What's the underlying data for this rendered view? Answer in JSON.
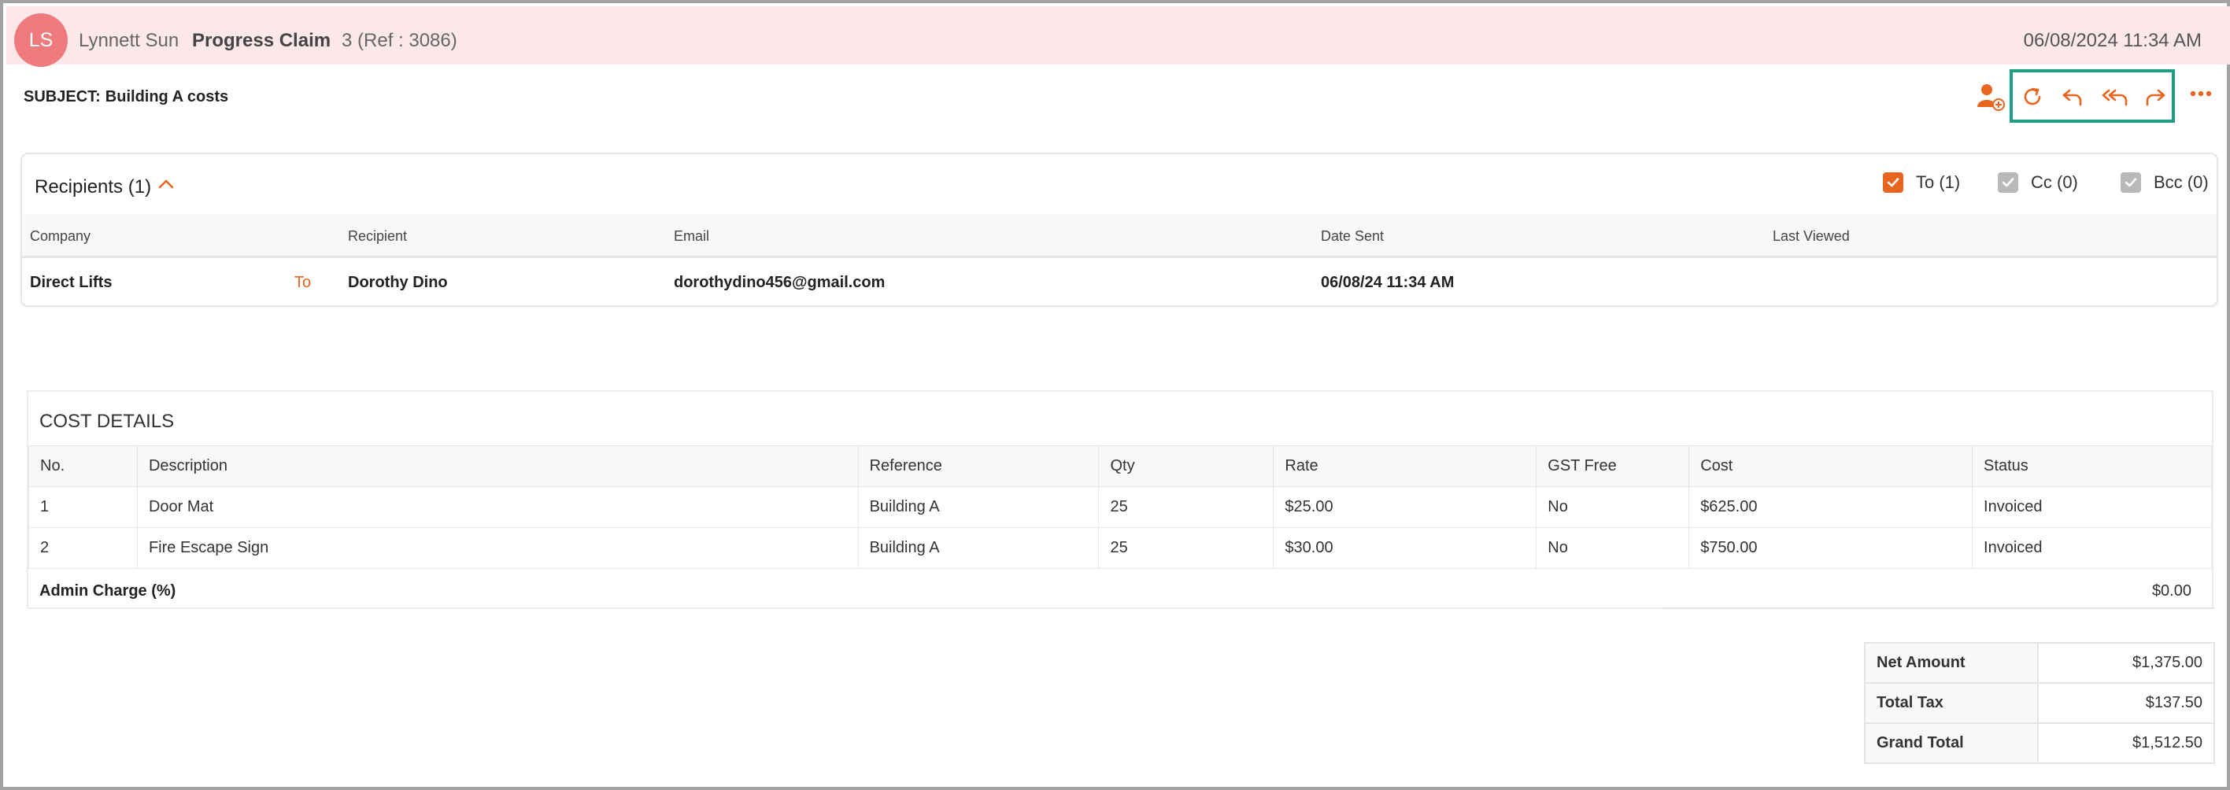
{
  "header": {
    "initials": "LS",
    "sender_name": "Lynnett Sun",
    "doc_type": "Progress Claim",
    "reference": "3 (Ref : 3086)",
    "datetime": "06/08/2024 11:34 AM"
  },
  "subject": {
    "label": "SUBJECT:",
    "text": "Building A costs"
  },
  "toolbar": {
    "assign_icon": "assign-user-icon",
    "refresh_icon": "refresh-icon",
    "reply_icon": "reply-icon",
    "reply_all_icon": "reply-all-icon",
    "forward_icon": "forward-icon",
    "more_icon": "more-options-icon",
    "accent_color": "#e8651f",
    "highlight_color": "#1f9e84"
  },
  "recipients": {
    "title": "Recipients (1)",
    "filters": [
      {
        "label": "To (1)",
        "checked": true,
        "color": "#e8651f"
      },
      {
        "label": "Cc (0)",
        "checked": true,
        "color": "#b9b9b9"
      },
      {
        "label": "Bcc (0)",
        "checked": true,
        "color": "#b9b9b9"
      }
    ],
    "columns": [
      "Company",
      "Recipient",
      "Email",
      "Date Sent",
      "Last Viewed"
    ],
    "rows": [
      {
        "company": "Direct Lifts",
        "type": "To",
        "recipient": "Dorothy Dino",
        "email": "dorothydino456@gmail.com",
        "date_sent": "06/08/24 11:34 AM",
        "last_viewed": ""
      }
    ]
  },
  "cost_details": {
    "title": "COST DETAILS",
    "columns": [
      "No.",
      "Description",
      "Reference",
      "Qty",
      "Rate",
      "GST Free",
      "Cost",
      "Status"
    ],
    "rows": [
      [
        "1",
        "Door Mat",
        "Building A",
        "25",
        "$25.00",
        "No",
        "$625.00",
        "Invoiced"
      ],
      [
        "2",
        "Fire Escape Sign",
        "Building A",
        "25",
        "$30.00",
        "No",
        "$750.00",
        "Invoiced"
      ]
    ],
    "admin_charge_label": "Admin Charge (%)",
    "admin_charge_value": "$0.00"
  },
  "totals": [
    {
      "label": "Net Amount",
      "value": "$1,375.00"
    },
    {
      "label": "Total Tax",
      "value": "$137.50"
    },
    {
      "label": "Grand Total",
      "value": "$1,512.50"
    }
  ]
}
